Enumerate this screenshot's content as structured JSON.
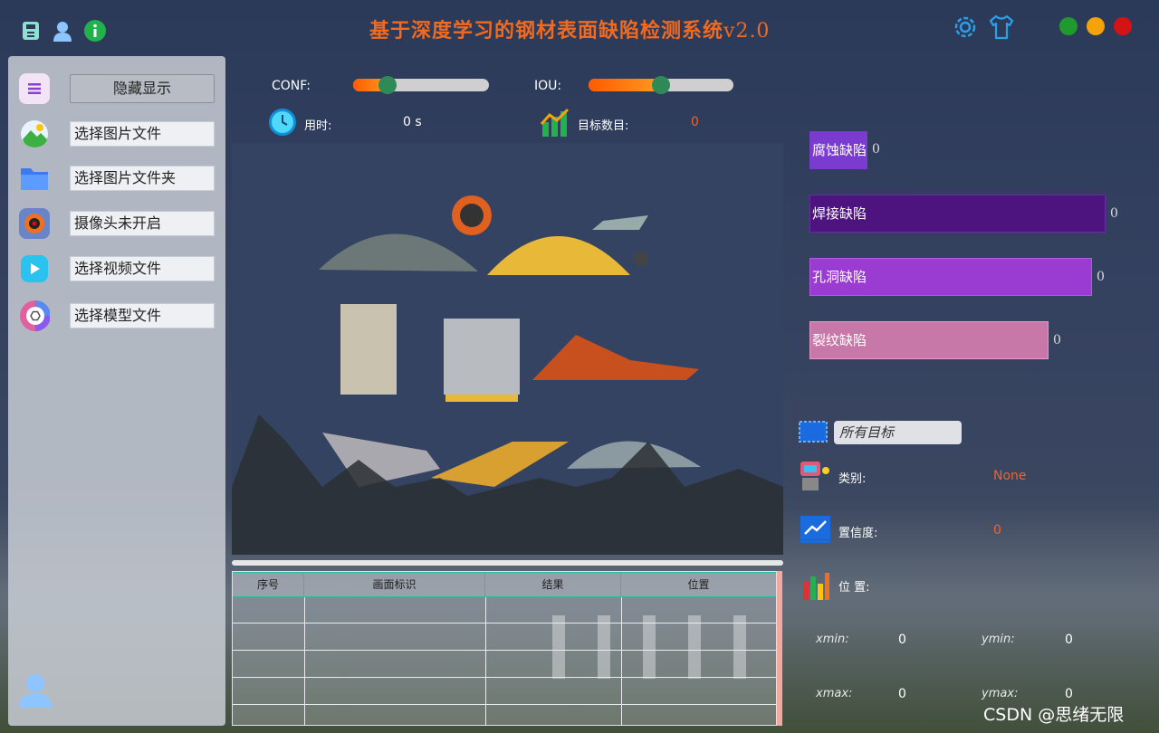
{
  "app": {
    "title": "基于深度学习的钢材表面缺陷检测系统",
    "version": "v2.0",
    "top_icons_left": [
      "save-icon",
      "user-icon",
      "info-icon"
    ],
    "top_icons_right": [
      "settings-icon",
      "theme-shirt-icon"
    ],
    "window_buttons": [
      {
        "name": "maximize",
        "color": "#1f9a2e"
      },
      {
        "name": "minimize",
        "color": "#f5a30a"
      },
      {
        "name": "close",
        "color": "#d41414"
      }
    ]
  },
  "sidebar": {
    "toggle_label": "隐藏显示",
    "items": [
      {
        "label": "选择图片文件",
        "icon": "image-icon"
      },
      {
        "label": "选择图片文件夹",
        "icon": "folder-icon"
      },
      {
        "label": "摄像头未开启",
        "icon": "camera-icon"
      },
      {
        "label": "选择视频文件",
        "icon": "video-icon"
      },
      {
        "label": "选择模型文件",
        "icon": "model-icon"
      }
    ]
  },
  "controls": {
    "conf": {
      "label": "CONF:",
      "value": 0.25
    },
    "iou": {
      "label": "IOU:",
      "value": 0.5
    },
    "time": {
      "label": "用时:",
      "value": "0 s"
    },
    "count": {
      "label": "目标数目:",
      "value": "0"
    }
  },
  "table": {
    "headers": [
      "序号",
      "画面标识",
      "结果",
      "位置"
    ],
    "rows": []
  },
  "defect_bars": [
    {
      "label": "腐蚀缺陷",
      "value": "0",
      "color": "#7a3ccf",
      "border": "#7a3ccf"
    },
    {
      "label": "焊接缺陷",
      "value": "0",
      "color": "#4d1480",
      "border": "#6a2aa8"
    },
    {
      "label": "孔洞缺陷",
      "value": "0",
      "color": "#9a3bd1",
      "border": "#b25be0"
    },
    {
      "label": "裂纹缺陷",
      "value": "0",
      "color": "#c878a8",
      "border": "#e89acb"
    }
  ],
  "details": {
    "target_select": "所有目标",
    "class_label": "类别:",
    "class_value": "None",
    "conf_label": "置信度:",
    "conf_value": "0",
    "position_label": "位 置:",
    "xmin_label": "xmin:",
    "xmin_value": "0",
    "ymin_label": "ymin:",
    "ymin_value": "0",
    "xmax_label": "xmax:",
    "xmax_value": "0",
    "ymax_label": "ymax:",
    "ymax_value": "0"
  },
  "watermark": "CSDN @思绪无限"
}
